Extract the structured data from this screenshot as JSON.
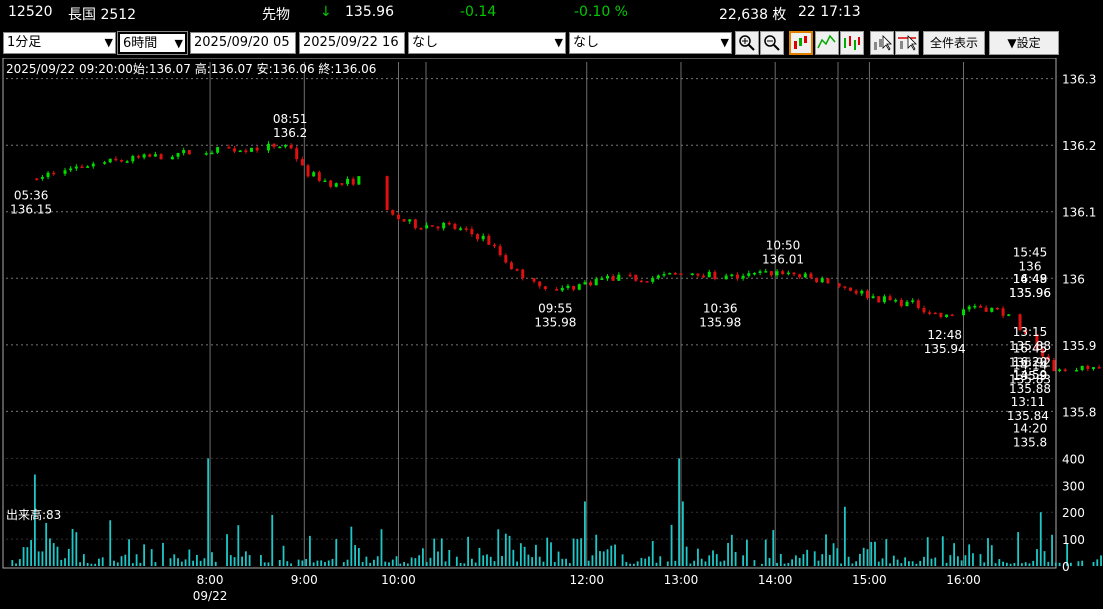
{
  "header": {
    "code": "12520",
    "name": "長国 2512",
    "kind": "先物",
    "arrow": "↓",
    "price": "135.96",
    "change": "-0.14",
    "change_pct": "-0.10 %",
    "volume": "22,638 枚",
    "time": "22 17:13",
    "colors": {
      "down": "#00c800",
      "text": "#ffffff"
    }
  },
  "toolbar": {
    "interval": "1分足",
    "span": "6時間",
    "from": "2025/09/20 05",
    "to": "2025/09/22 16",
    "indicator1": "なし",
    "indicator2": "なし",
    "zoom_in_icon": "zoom-in-icon",
    "zoom_out_icon": "zoom-out-icon",
    "full_view": "全件表示",
    "settings": "▼設定"
  },
  "info_line": "2025/09/22 09:20:00始:136.07 高:136.07 安:136.06 終:136.06",
  "volume_label": "出来高:83",
  "chart_data": {
    "type": "candlestick",
    "colors": {
      "up": "#00dd00",
      "down": "#dd1111",
      "volume": "#1ec8c8",
      "grid": "#777777"
    },
    "y_axis": {
      "ticks": [
        "136.3",
        "136.2",
        "136.1",
        "136",
        "135.9",
        "135.8"
      ],
      "range": [
        135.73,
        136.325
      ]
    },
    "volume_axis": {
      "ticks": [
        "400",
        "300",
        "200",
        "100",
        "0"
      ],
      "range": [
        0,
        420
      ]
    },
    "x_axis": {
      "ticks": [
        {
          "label": "8:00",
          "t": 480
        },
        {
          "label": "9:00",
          "t": 540
        },
        {
          "label": "10:00",
          "t": 600
        },
        {
          "label": "12:00",
          "t": 720
        },
        {
          "label": "13:00",
          "t": 780
        },
        {
          "label": "14:00",
          "t": 840
        },
        {
          "label": "15:00",
          "t": 900
        },
        {
          "label": "16:00",
          "t": 960
        }
      ],
      "date_label": "09/22",
      "range": [
        350,
        1017
      ]
    },
    "price_path": [
      [
        366,
        136.15
      ],
      [
        400,
        136.17
      ],
      [
        470,
        136.19
      ],
      [
        531,
        136.2
      ],
      [
        540,
        136.16
      ],
      [
        560,
        136.14
      ],
      [
        577,
        136.15
      ],
      [
        590,
        136.1
      ],
      [
        610,
        136.08
      ],
      [
        630,
        136.08
      ],
      [
        655,
        136.06
      ],
      [
        675,
        136.01
      ],
      [
        700,
        135.98
      ],
      [
        730,
        136.0
      ],
      [
        760,
        136.0
      ],
      [
        790,
        136.01
      ],
      [
        805,
        136.0
      ],
      [
        845,
        136.01
      ],
      [
        880,
        135.99
      ],
      [
        905,
        135.97
      ],
      [
        930,
        135.96
      ],
      [
        948,
        135.94
      ],
      [
        965,
        135.96
      ],
      [
        985,
        135.95
      ],
      [
        1001,
        135.91
      ],
      [
        1010,
        135.88
      ],
      [
        1020,
        135.86
      ],
      [
        1040,
        135.87
      ],
      [
        1060,
        135.87
      ],
      [
        1075,
        135.86
      ],
      [
        1090,
        135.83
      ],
      [
        1110,
        135.81
      ],
      [
        1130,
        135.8
      ],
      [
        1145,
        135.81
      ],
      [
        1175,
        135.81
      ],
      [
        1190,
        135.83
      ],
      [
        1205,
        135.82
      ],
      [
        1225,
        135.85
      ],
      [
        1245,
        135.9
      ],
      [
        1269,
        135.96
      ],
      [
        1280,
        135.93
      ],
      [
        1299,
        135.88
      ],
      [
        1310,
        135.93
      ],
      [
        1330,
        135.94
      ],
      [
        1345,
        135.96
      ],
      [
        1365,
        136.0
      ],
      [
        1380,
        135.96
      ],
      [
        1400,
        135.94
      ],
      [
        1415,
        135.91
      ],
      [
        1440,
        135.9
      ],
      [
        1460,
        135.9
      ],
      [
        1473,
        135.92
      ],
      [
        1500,
        135.95
      ],
      [
        1530,
        135.94
      ],
      [
        1550,
        135.93
      ],
      [
        1576,
        135.96
      ]
    ],
    "annotations": [
      {
        "time": "05:36",
        "value": "136.15",
        "t": 366,
        "v": 136.15,
        "pos": "below"
      },
      {
        "time": "08:51",
        "value": "136.2",
        "t": 531,
        "v": 136.2,
        "pos": "above"
      },
      {
        "time": "09:55",
        "value": "135.98",
        "t": 700,
        "v": 135.98,
        "pos": "below"
      },
      {
        "time": "10:36",
        "value": "135.98",
        "t": 805,
        "v": 135.98,
        "pos": "below"
      },
      {
        "time": "10:50",
        "value": "136.01",
        "t": 845,
        "v": 136.01,
        "pos": "above"
      },
      {
        "time": "12:48",
        "value": "135.94",
        "t": 948,
        "v": 135.94,
        "pos": "below"
      },
      {
        "time": "13:11",
        "value": "135.84",
        "t": 1001,
        "v": 135.84,
        "pos": "below"
      },
      {
        "time": "13:15",
        "value": "135.88",
        "t": 1010,
        "v": 135.88,
        "pos": "above"
      },
      {
        "time": "14:14",
        "value": "135.83",
        "t": 1194,
        "v": 135.83,
        "pos": "above"
      },
      {
        "time": "14:20",
        "value": "135.8",
        "t": 1205,
        "v": 135.8,
        "pos": "below"
      },
      {
        "time": "14:49",
        "value": "135.96",
        "t": 1269,
        "v": 135.96,
        "pos": "above"
      },
      {
        "time": "14:59",
        "value": "135.88",
        "t": 1299,
        "v": 135.88,
        "pos": "below"
      },
      {
        "time": "15:45",
        "value": "136",
        "t": 1365,
        "v": 136.0,
        "pos": "above"
      },
      {
        "time": "16:20",
        "value": "135.9",
        "t": 1440,
        "v": 135.9,
        "pos": "below"
      },
      {
        "time": "16:45",
        "value": "135.92",
        "t": 1473,
        "v": 135.92,
        "pos": "below"
      },
      {
        "time": "16:48",
        "value": "135.96",
        "t": 1576,
        "v": 135.96,
        "pos": "above"
      }
    ],
    "volume_spikes": [
      {
        "t": 369,
        "v": 340
      },
      {
        "t": 377,
        "v": 160
      },
      {
        "t": 415,
        "v": 170
      },
      {
        "t": 478,
        "v": 400
      },
      {
        "t": 520,
        "v": 190
      },
      {
        "t": 669,
        "v": 120
      },
      {
        "t": 718,
        "v": 240
      },
      {
        "t": 778,
        "v": 400
      },
      {
        "t": 781,
        "v": 240
      },
      {
        "t": 885,
        "v": 220
      },
      {
        "t": 1010,
        "v": 200
      },
      {
        "t": 1060,
        "v": 190
      },
      {
        "t": 1240,
        "v": 240
      },
      {
        "t": 1260,
        "v": 310
      },
      {
        "t": 1275,
        "v": 260
      },
      {
        "t": 1290,
        "v": 270
      },
      {
        "t": 1305,
        "v": 360
      },
      {
        "t": 1325,
        "v": 410
      }
    ]
  }
}
